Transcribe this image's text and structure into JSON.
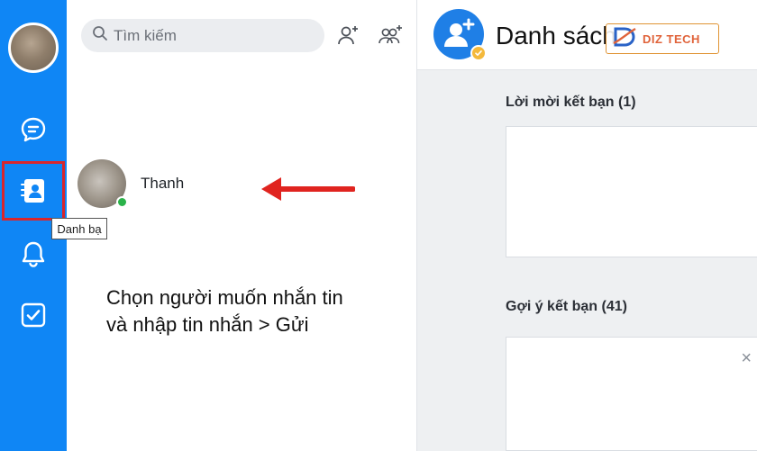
{
  "sidebar": {
    "items": [
      {
        "name": "messages",
        "icon": "chat-icon"
      },
      {
        "name": "contacts",
        "icon": "contact-book-icon",
        "selected": true
      },
      {
        "name": "notifications",
        "icon": "bell-icon"
      },
      {
        "name": "todo",
        "icon": "checkbox-icon"
      }
    ],
    "tooltip": "Danh bạ",
    "accent": "#0f86f5",
    "highlight_color": "#d9262c"
  },
  "search": {
    "placeholder": "Tìm kiếm"
  },
  "contacts": [
    {
      "name": "Thanh",
      "online": true
    }
  ],
  "annotation": {
    "line1": "Chọn người muốn nhắn tin",
    "line2": "và nhập tin nhắn > Gửi"
  },
  "header": {
    "title": "Danh sách"
  },
  "watermark": {
    "text": "DIZ TECH"
  },
  "sections": {
    "friend_requests": "Lời mời kết bạn (1)",
    "friend_suggestions": "Gợi ý kết bạn (41)",
    "close_symbol": "×"
  }
}
